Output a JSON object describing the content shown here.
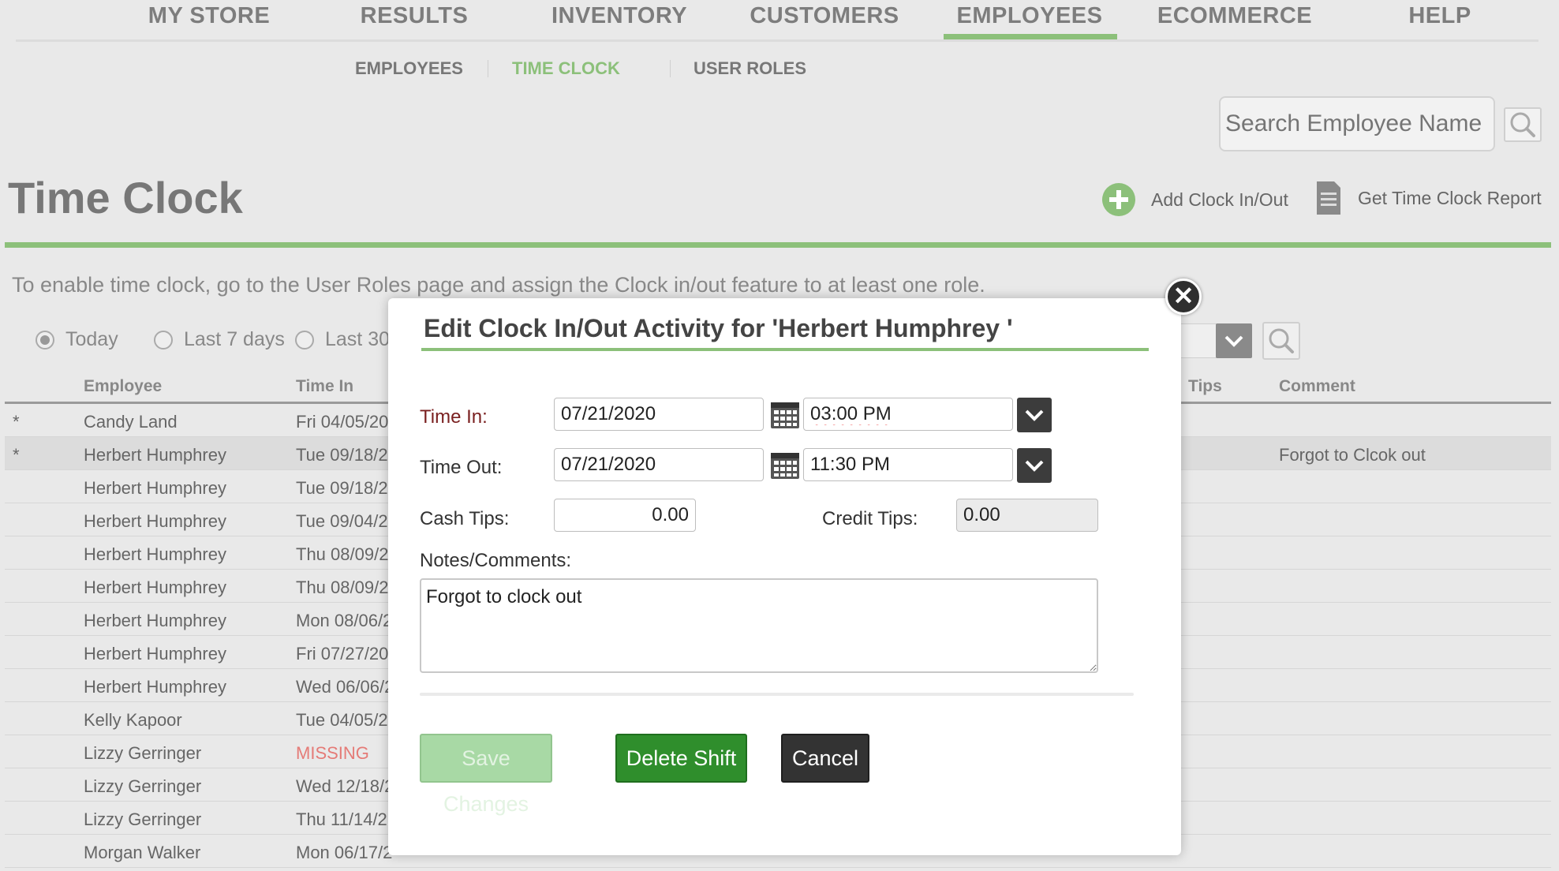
{
  "nav": {
    "items": [
      "MY STORE",
      "RESULTS",
      "INVENTORY",
      "CUSTOMERS",
      "EMPLOYEES",
      "ECOMMERCE",
      "HELP"
    ],
    "active": "EMPLOYEES"
  },
  "subnav": {
    "items": [
      "EMPLOYEES",
      "TIME CLOCK",
      "USER ROLES"
    ],
    "active": "TIME CLOCK"
  },
  "search": {
    "placeholder": "Search Employee Name",
    "icon": "search-icon"
  },
  "page": {
    "title": "Time Clock",
    "add_label": "Add Clock In/Out",
    "report_label": "Get Time Clock Report",
    "info": "To enable time clock, go to the User Roles page and assign the Clock in/out feature to at least one role."
  },
  "filters": {
    "options": [
      "Today",
      "Last 7 days",
      "Last 30"
    ],
    "selected": "Today"
  },
  "table": {
    "headers": [
      "Employee",
      "Time In",
      "Tips",
      "Comment"
    ],
    "rows": [
      {
        "flag": "*",
        "employee": "Candy Land",
        "time_in": "Fri 04/05/20",
        "comment": ""
      },
      {
        "flag": "*",
        "employee": "Herbert Humphrey",
        "time_in": "Tue 09/18/2",
        "comment": "Forgot to Clcok out"
      },
      {
        "flag": "",
        "employee": "Herbert Humphrey",
        "time_in": "Tue 09/18/2",
        "comment": ""
      },
      {
        "flag": "",
        "employee": "Herbert Humphrey",
        "time_in": "Tue 09/04/2",
        "comment": ""
      },
      {
        "flag": "",
        "employee": "Herbert Humphrey",
        "time_in": "Thu 08/09/2",
        "comment": ""
      },
      {
        "flag": "",
        "employee": "Herbert Humphrey",
        "time_in": "Thu 08/09/2",
        "comment": ""
      },
      {
        "flag": "",
        "employee": "Herbert Humphrey",
        "time_in": "Mon 08/06/2",
        "comment": ""
      },
      {
        "flag": "",
        "employee": "Herbert Humphrey",
        "time_in": "Fri 07/27/20",
        "comment": ""
      },
      {
        "flag": "",
        "employee": "Herbert Humphrey",
        "time_in": "Wed 06/06/2",
        "comment": ""
      },
      {
        "flag": "",
        "employee": "Kelly Kapoor",
        "time_in": "Tue 04/05/2",
        "comment": ""
      },
      {
        "flag": "",
        "employee": "Lizzy Gerringer",
        "time_in": "MISSING",
        "comment": ""
      },
      {
        "flag": "",
        "employee": "Lizzy Gerringer",
        "time_in": "Wed 12/18/2",
        "comment": ""
      },
      {
        "flag": "",
        "employee": "Lizzy Gerringer",
        "time_in": "Thu 11/14/2",
        "comment": ""
      },
      {
        "flag": "",
        "employee": "Morgan Walker",
        "time_in": "Mon 06/17/2",
        "comment": ""
      }
    ]
  },
  "modal": {
    "title": "Edit Clock In/Out Activity for 'Herbert Humphrey '",
    "close_icon": "close-icon",
    "time_in_label": "Time In:",
    "time_in_date": "07/21/2020",
    "time_in_time": "03:00 PM",
    "time_out_label": "Time Out:",
    "time_out_date": "07/21/2020",
    "time_out_time": "11:30 PM",
    "cash_tips_label": "Cash Tips:",
    "cash_tips": "0.00",
    "credit_tips_label": "Credit Tips:",
    "credit_tips": "0.00",
    "notes_label": "Notes/Comments:",
    "notes": "Forgot to clock out",
    "save_label": "Save Changes",
    "delete_label": "Delete Shift",
    "cancel_label": "Cancel"
  },
  "colors": {
    "accent_green": "#8cc07a",
    "delete_green": "#2f8e2c",
    "save_disabled": "#a8d9a5",
    "missing_red": "#e57b77"
  }
}
